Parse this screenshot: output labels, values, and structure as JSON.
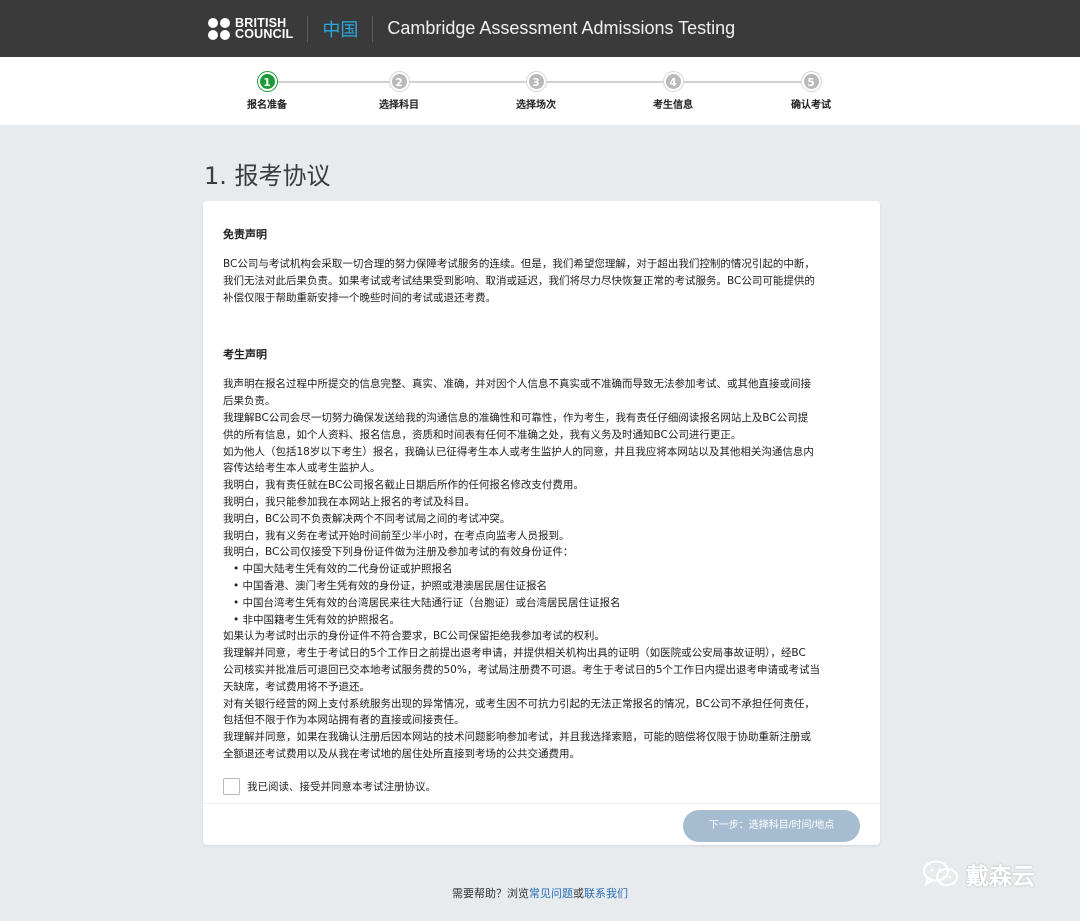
{
  "header": {
    "logo_line1": "BRITISH",
    "logo_line2": "COUNCIL",
    "region": "中国",
    "title": "Cambridge Assessment Admissions Testing"
  },
  "steps": [
    {
      "num": "1",
      "label": "报名准备",
      "active": true
    },
    {
      "num": "2",
      "label": "选择科目",
      "active": false
    },
    {
      "num": "3",
      "label": "选择场次",
      "active": false
    },
    {
      "num": "4",
      "label": "考生信息",
      "active": false
    },
    {
      "num": "5",
      "label": "确认考试",
      "active": false
    }
  ],
  "page_title": "1. 报考协议",
  "disclaimer": {
    "heading": "免责声明",
    "lines": [
      "BC公司与考试机构会采取一切合理的努力保障考试服务的连续。但是，我们希望您理解，对于超出我们控制的情况引起的中断，",
      "我们无法对此后果负责。如果考试或考试结果受到影响、取消或延迟，我们将尽力尽快恢复正常的考试服务。BC公司可能提供的",
      "补偿仅限于帮助重新安排一个晚些时间的考试或退还考费。"
    ]
  },
  "declaration": {
    "heading": "考生声明",
    "lines": [
      "我声明在报名过程中所提交的信息完整、真实、准确，并对因个人信息不真实或不准确而导致无法参加考试、或其他直接或间接",
      "后果负责。",
      "我理解BC公司会尽一切努力确保发送给我的沟通信息的准确性和可靠性，作为考生，我有责任仔细阅读报名网站上及BC公司提",
      "供的所有信息，如个人资料、报名信息，资质和时间表有任何不准确之处，我有义务及时通知BC公司进行更正。",
      "如为他人（包括18岁以下考生）报名，我确认已征得考生本人或考生监护人的同意，并且我应将本网站以及其他相关沟通信息内",
      "容传达给考生本人或考生监护人。",
      "我明白，我有责任就在BC公司报名截止日期后所作的任何报名修改支付费用。",
      "我明白，我只能参加我在本网站上报名的考试及科目。",
      "我明白，BC公司不负责解决两个不同考试局之间的考试冲突。",
      "我明白，我有义务在考试开始时间前至少半小时，在考点向监考人员报到。",
      "我明白，BC公司仅接受下列身份证件做为注册及参加考试的有效身份证件："
    ],
    "bullets": [
      "• 中国大陆考生凭有效的二代身份证或护照报名",
      "• 中国香港、澳门考生凭有效的身份证，护照或港澳居民居住证报名",
      "• 中国台湾考生凭有效的台湾居民来往大陆通行证（台胞证）或台湾居民居住证报名",
      "• 非中国籍考生凭有效的护照报名。"
    ],
    "lines_after": [
      "如果认为考试时出示的身份证件不符合要求，BC公司保留拒绝我参加考试的权利。",
      "我理解并同意，考生于考试日的5个工作日之前提出退考申请，并提供相关机构出具的证明（如医院或公安局事故证明），经BC",
      "公司核实并批准后可退回已交本地考试服务费的50%，考试局注册费不可退。考生于考试日的5个工作日内提出退考申请或考试当",
      "天缺席，考试费用将不予退还。",
      "对有关银行经营的网上支付系统服务出现的异常情况，或考生因不可抗力引起的无法正常报名的情况，BC公司不承担任何责任，",
      "包括但不限于作为本网站拥有者的直接或间接责任。",
      "我理解并同意，如果在我确认注册后因本网站的技术问题影响参加考试，并且我选择索赔，可能的赔偿将仅限于协助重新注册或",
      "全额退还考试费用以及从我在考试地的居住处所直接到考场的公共交通费用。"
    ]
  },
  "agree_label": "我已阅读、接受并同意本考试注册协议。",
  "next_button": "下一步：选择科目/时间/地点",
  "help": {
    "prefix": "需要帮助？浏览",
    "faq": "常见问题",
    "or": "或",
    "contact": "联系我们"
  },
  "watermark": "戴森云",
  "colors": {
    "header_bg": "#3a3a3b",
    "region": "#29a9e1",
    "active_step": "#1c9a3a",
    "button_disabled": "#a6bdd1",
    "link": "#2a6ebb"
  }
}
